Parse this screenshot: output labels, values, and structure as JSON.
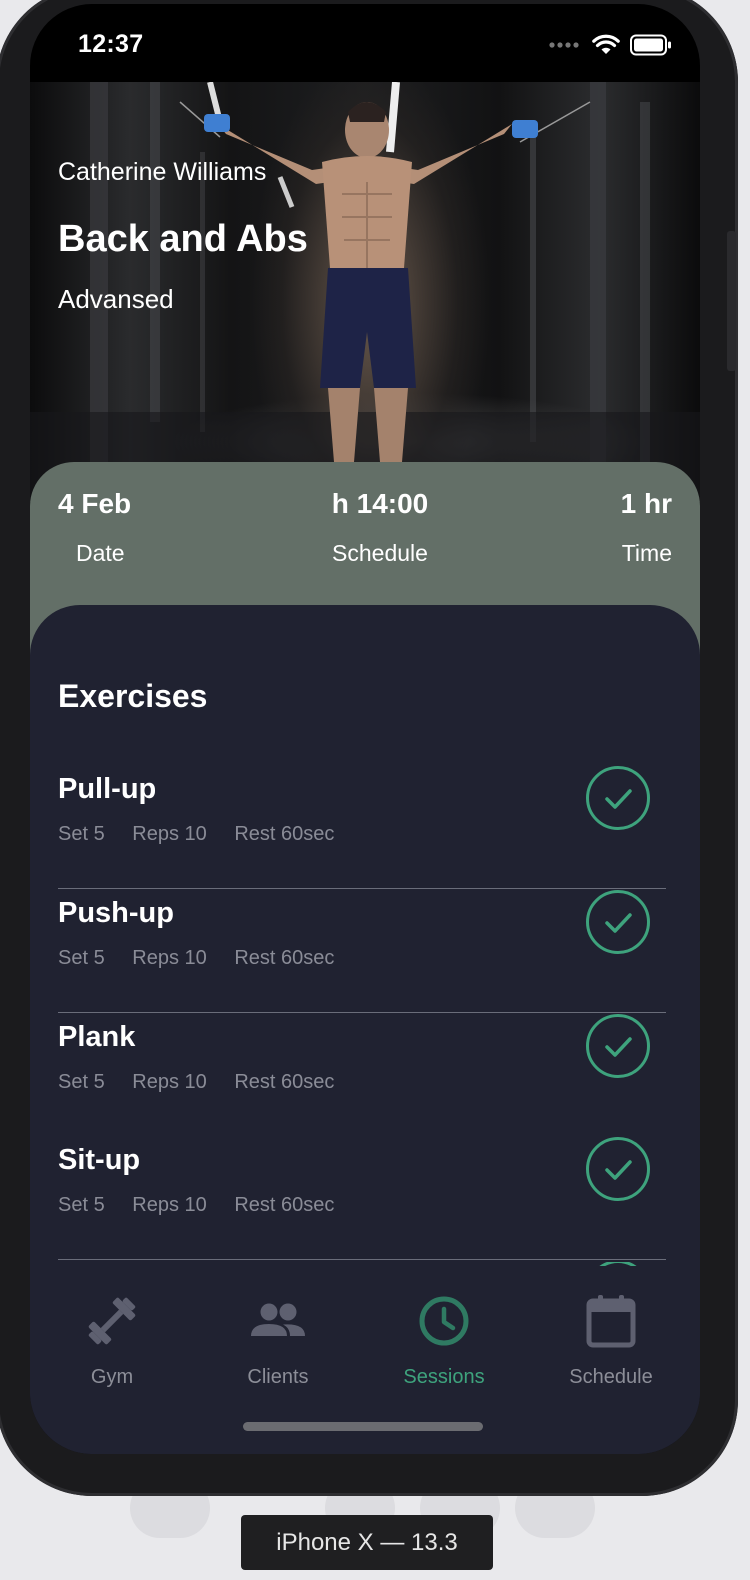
{
  "status_bar": {
    "time": "12:37"
  },
  "hero": {
    "client_name": "Catherine Williams",
    "workout_title": "Back and Abs",
    "level": "Advansed"
  },
  "info": {
    "date_value": "4 Feb",
    "date_label": "Date",
    "schedule_value": "h 14:00",
    "schedule_label": "Schedule",
    "time_value": "1 hr",
    "time_label": "Time"
  },
  "exercises": {
    "title": "Exercises",
    "items": [
      {
        "name": "Pull-up",
        "set": "Set 5",
        "reps": "Reps 10",
        "rest": "Rest 60sec",
        "done": true
      },
      {
        "name": "Push-up",
        "set": "Set 5",
        "reps": "Reps 10",
        "rest": "Rest 60sec",
        "done": true
      },
      {
        "name": "Plank",
        "set": "Set 5",
        "reps": "Reps 10",
        "rest": "Rest 60sec",
        "done": true
      },
      {
        "name": "Sit-up",
        "set": "Set 5",
        "reps": "Reps 10",
        "rest": "Rest 60sec",
        "done": true
      }
    ]
  },
  "tabbar": {
    "items": [
      {
        "label": "Gym",
        "icon": "dumbbell-icon"
      },
      {
        "label": "Clients",
        "icon": "people-icon"
      },
      {
        "label": "Sessions",
        "icon": "clock-icon"
      },
      {
        "label": "Schedule",
        "icon": "calendar-icon"
      }
    ],
    "active": "Sessions"
  },
  "colors": {
    "accent": "#3ea37d",
    "panel": "#202231",
    "info_band": "#636f67"
  },
  "simulator": {
    "device_label": "iPhone X — 13.3"
  }
}
